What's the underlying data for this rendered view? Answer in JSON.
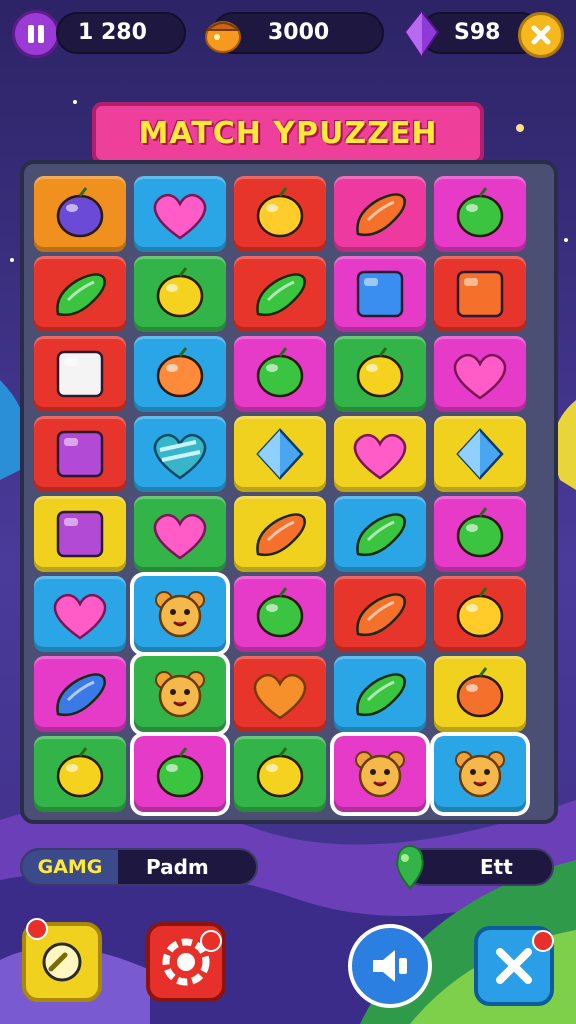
{
  "hud": {
    "score": "1 280",
    "coins": "3000",
    "gems": "S98"
  },
  "title": "MATCH YPUZZEH",
  "board": {
    "rows": [
      [
        {
          "color": "#f0901e",
          "icon": "candy-icon"
        },
        {
          "color": "#2aa6e6",
          "icon": "heart-icon"
        },
        {
          "color": "#e8352c",
          "icon": "smiley-fruit-icon"
        },
        {
          "color": "#ee3aa0",
          "icon": "carrot-icon"
        },
        {
          "color": "#e63ac8",
          "icon": "leaf-icon"
        }
      ],
      [
        {
          "color": "#e8352c",
          "icon": "pepper-icon"
        },
        {
          "color": "#33b449",
          "icon": "smiley-face-icon"
        },
        {
          "color": "#e8352c",
          "icon": "cucumber-icon"
        },
        {
          "color": "#e63ac8",
          "icon": "gem-bar-icon"
        },
        {
          "color": "#e8352c",
          "icon": "square-block-icon"
        }
      ],
      [
        {
          "color": "#e8352c",
          "icon": "note-card-icon"
        },
        {
          "color": "#2aa6e6",
          "icon": "cake-slice-icon"
        },
        {
          "color": "#e63ac8",
          "icon": "bag-icon"
        },
        {
          "color": "#33b449",
          "icon": "melon-icon"
        },
        {
          "color": "#e63ac8",
          "icon": "heart-icon"
        }
      ],
      [
        {
          "color": "#e8352c",
          "icon": "purple-square-icon"
        },
        {
          "color": "#2aa6e6",
          "icon": "striped-heart-icon"
        },
        {
          "color": "#f0d21e",
          "icon": "blue-gem-icon"
        },
        {
          "color": "#f0d21e",
          "icon": "heart-icon"
        },
        {
          "color": "#f0d21e",
          "icon": "prism-icon"
        }
      ],
      [
        {
          "color": "#f0d21e",
          "icon": "purple-block-icon"
        },
        {
          "color": "#33b449",
          "icon": "heart-icon"
        },
        {
          "color": "#f0d21e",
          "icon": "carrot-icon"
        },
        {
          "color": "#2aa6e6",
          "icon": "bean-icon"
        },
        {
          "color": "#e63ac8",
          "icon": "flower-fruit-icon"
        }
      ],
      [
        {
          "color": "#2aa6e6",
          "icon": "heart-icon"
        },
        {
          "color": "#2aa6e6",
          "icon": "bear-face-icon"
        },
        {
          "color": "#e63ac8",
          "icon": "balloon-icon"
        },
        {
          "color": "#e8352c",
          "icon": "carrot-icon"
        },
        {
          "color": "#e8352c",
          "icon": "orange-icon"
        }
      ],
      [
        {
          "color": "#e63ac8",
          "icon": "banana-icon"
        },
        {
          "color": "#33b449",
          "icon": "bear-face-icon"
        },
        {
          "color": "#e8352c",
          "icon": "orange-heart-icon"
        },
        {
          "color": "#2aa6e6",
          "icon": "green-bean-icon"
        },
        {
          "color": "#f0d21e",
          "icon": "pumpkin-icon"
        }
      ],
      [
        {
          "color": "#33b449",
          "icon": "watermelon-icon"
        },
        {
          "color": "#e63ac8",
          "icon": "surfboard-icon"
        },
        {
          "color": "#33b449",
          "icon": "bird-icon"
        },
        {
          "color": "#e63ac8",
          "icon": "bear-face-icon"
        },
        {
          "color": "#2aa6e6",
          "icon": "bear-face-icon"
        }
      ]
    ]
  },
  "footer": {
    "game_label": "GAMG",
    "mode_value": "Padm",
    "exit_label": "Ett"
  },
  "colors": {
    "background": "#3a2c7a",
    "banner": "#ee3f9b",
    "title_text": "#ffe93a",
    "board": "#4a4f73"
  }
}
